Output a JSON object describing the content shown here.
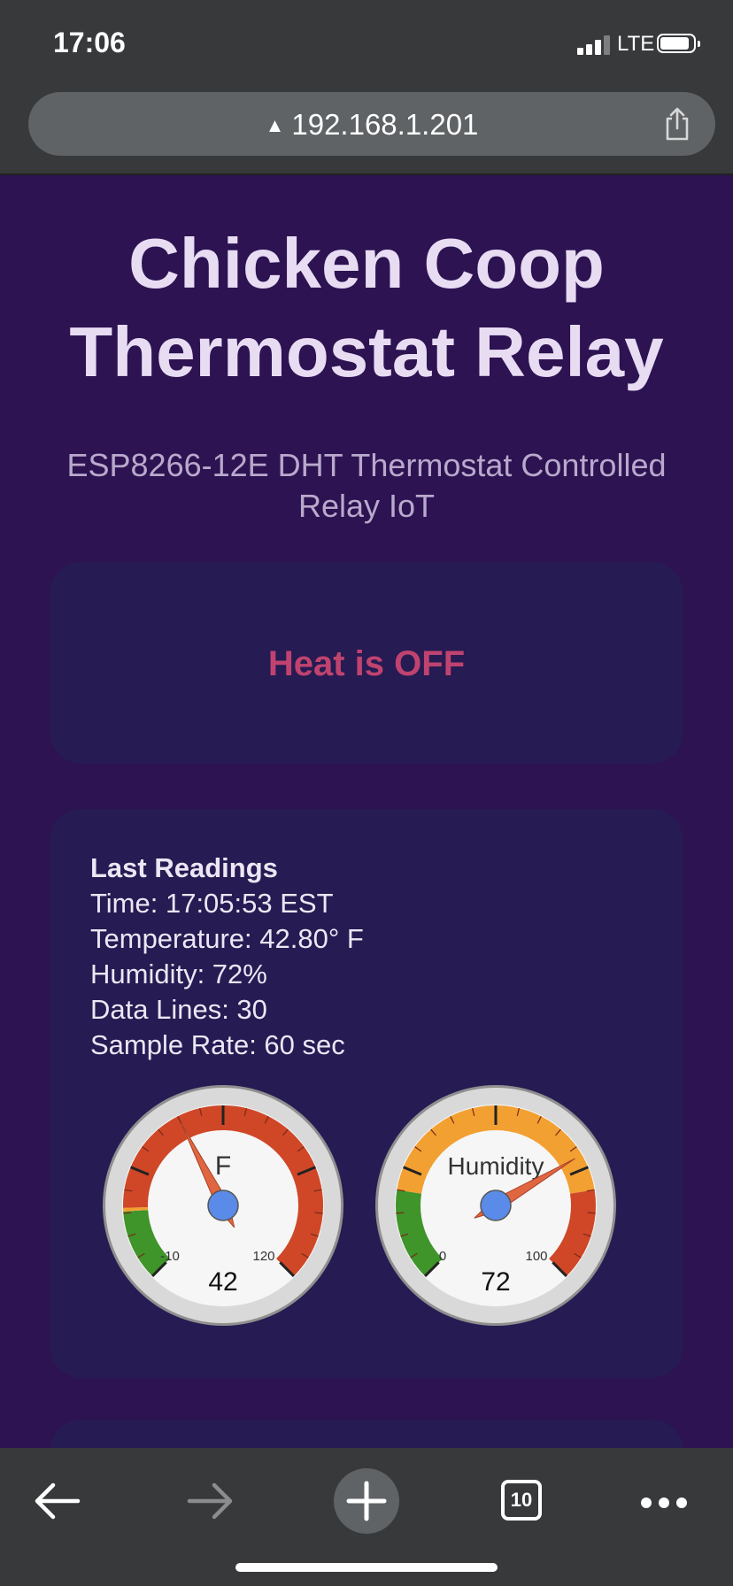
{
  "status_bar": {
    "time": "17:06",
    "network": "LTE",
    "icons": [
      "signal-bars-icon",
      "battery-icon"
    ]
  },
  "browser": {
    "url": "192.168.1.201",
    "security_icon": "warning-triangle-icon",
    "share_icon": "share-icon",
    "tab_count": "10",
    "toolbar_icons": [
      "back-arrow-icon",
      "forward-arrow-icon",
      "new-tab-plus-icon",
      "tabs-icon",
      "more-dots-icon"
    ]
  },
  "page": {
    "title_line1": "Chicken Coop",
    "title_line2": "Thermostat Relay",
    "subtitle": "ESP8266-12E DHT Thermostat Controlled Relay IoT",
    "heat_status": "Heat is OFF",
    "readings": {
      "heading": "Last Readings",
      "time": "Time: 17:05:53 EST",
      "temperature": "Temperature: 42.80° F",
      "humidity": "Humidity: 72%",
      "data_lines": "Data Lines: 30",
      "sample_rate": "Sample Rate: 60 sec"
    }
  },
  "gauges": [
    {
      "label": "F",
      "min": -10,
      "max": 120,
      "value": 42,
      "min_label": "-10",
      "max_label": "120",
      "value_label": "42",
      "bands": [
        {
          "from": -10,
          "to": 10,
          "color": "#3f942a"
        },
        {
          "from": 10,
          "to": 11,
          "color": "#f2a031"
        },
        {
          "from": 11,
          "to": 120,
          "color": "#cf4727"
        }
      ]
    },
    {
      "label": "Humidity",
      "min": 0,
      "max": 100,
      "value": 72,
      "min_label": "0",
      "max_label": "100",
      "value_label": "72",
      "bands": [
        {
          "from": 0,
          "to": 20,
          "color": "#3f942a"
        },
        {
          "from": 20,
          "to": 80,
          "color": "#f2a031"
        },
        {
          "from": 80,
          "to": 100,
          "color": "#cf4727"
        }
      ]
    }
  ],
  "colors": {
    "page_bg": "#2d1352",
    "card_bg": "#261b52",
    "title": "#e8dcf3",
    "heat_off": "#c0436f",
    "needle": "#e0663f",
    "needle_hub": "#5b8be8"
  }
}
